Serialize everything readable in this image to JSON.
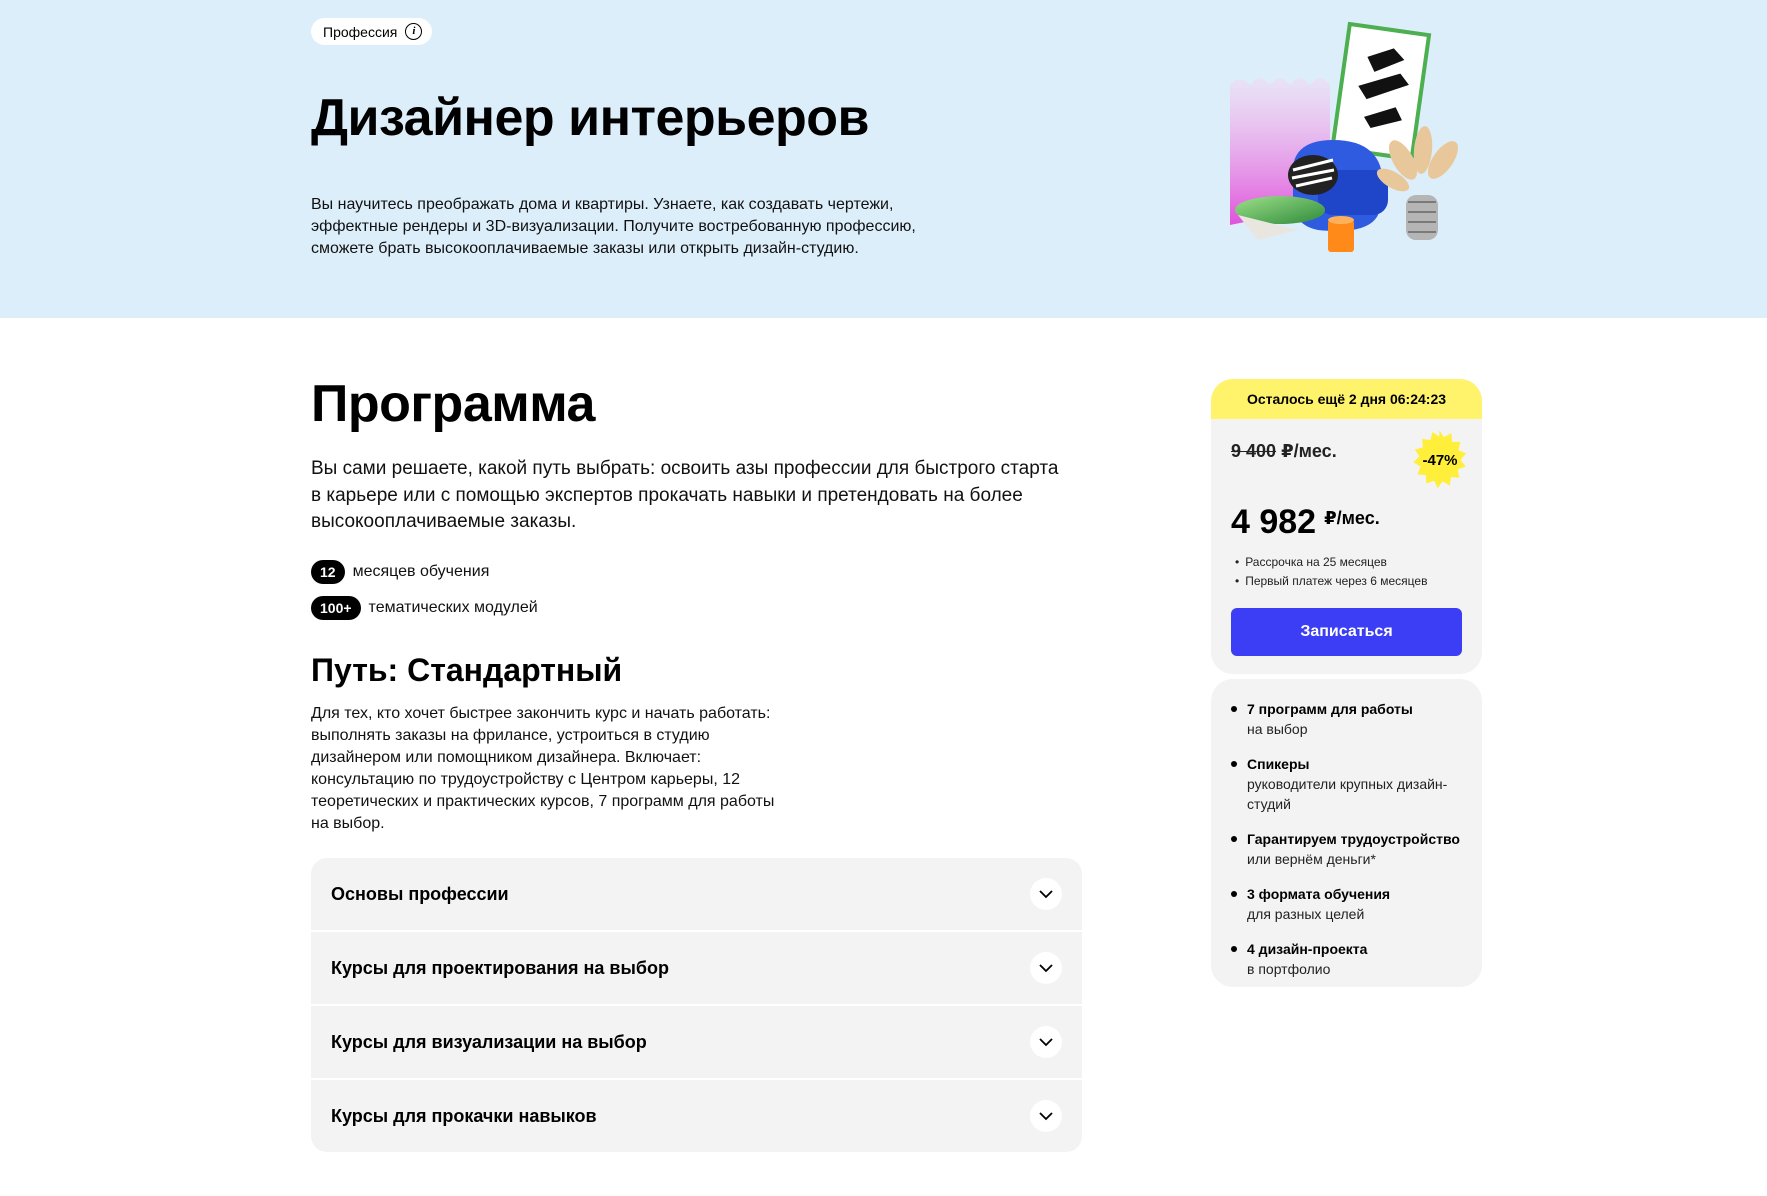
{
  "hero": {
    "tag_label": "Профессия",
    "info_glyph": "i",
    "title": "Дизайнер интерьеров",
    "description": "Вы научитесь преображать дома и квартиры. Узнаете, как создавать чертежи, эффектные рендеры и 3D-визуализации. Получите востребованную профессию, сможете брать высокооплачиваемые заказы или открыть дизайн-студию."
  },
  "program": {
    "title": "Программа",
    "description": "Вы сами решаете, какой путь выбрать: освоить азы профессии для быстрого старта в карьере или с помощью экспертов прокачать навыки и претендовать на более высокооплачиваемые заказы.",
    "stats": [
      {
        "value": "12",
        "label": "месяцев обучения"
      },
      {
        "value": "100+",
        "label": "тематических модулей"
      }
    ],
    "path_title": "Путь: Стандартный",
    "path_description": "Для тех, кто хочет быстрее закончить курс и начать работать: выполнять заказы на фрилансе, устроиться в студию дизайнером или помощником дизайнера. Включает: консультацию по трудоустройству с Центром карьеры, 12 теоретических и практических курсов, 7 программ для работы на выбор.",
    "accordion": [
      {
        "label": "Основы профессии"
      },
      {
        "label": "Курсы для проектирования на выбор"
      },
      {
        "label": "Курсы для визуализации на выбор"
      },
      {
        "label": "Курсы для прокачки навыков"
      }
    ]
  },
  "price": {
    "timer": "Осталось ещё 2 дня 06:24:23",
    "old_amount": "9 400",
    "old_unit": "₽/мес.",
    "discount": "-47%",
    "new_amount": "4 982",
    "new_unit": "₽/мес.",
    "notes": [
      "Рассрочка на 25 месяцев",
      "Первый платеж через 6 месяцев"
    ],
    "cta": "Записаться"
  },
  "features": [
    {
      "title": "7 программ для работы",
      "sub": "на выбор"
    },
    {
      "title": "Спикеры",
      "sub": "руководители крупных дизайн-студий"
    },
    {
      "title": "Гарантируем трудоустройство",
      "sub": "или вернём деньги*"
    },
    {
      "title": "3 формата обучения",
      "sub": "для разных целей"
    },
    {
      "title": "4 дизайн-проекта",
      "sub": "в портфолио"
    }
  ],
  "colors": {
    "hero_bg": "#ddeefb",
    "timer_bg": "#fff36b",
    "badge_bg": "#ffee3a",
    "cta_bg": "#3b3ef5",
    "card_bg": "#f3f3f3"
  }
}
